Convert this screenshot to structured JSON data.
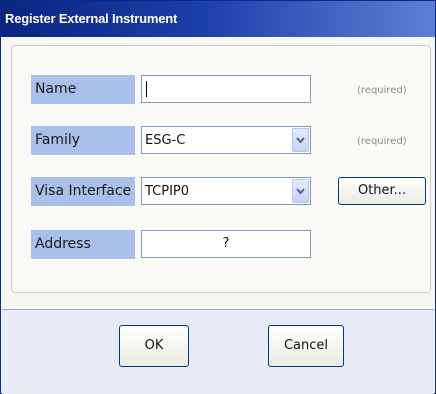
{
  "window": {
    "title": "Register External Instrument"
  },
  "form": {
    "name": {
      "label": "Name",
      "value": "",
      "hint": "(required)"
    },
    "family": {
      "label": "Family",
      "value": "ESG-C",
      "hint": "(required)"
    },
    "visa_interface": {
      "label": "Visa Interface",
      "value": "TCPIP0",
      "other_label": "Other..."
    },
    "address": {
      "label": "Address",
      "value": "?"
    }
  },
  "buttons": {
    "ok_label": "OK",
    "cancel_label": "Cancel"
  },
  "colors": {
    "title_bar": "#0a2480",
    "label_background": "#a9c0ea",
    "footer_background": "#e7ebf6"
  }
}
